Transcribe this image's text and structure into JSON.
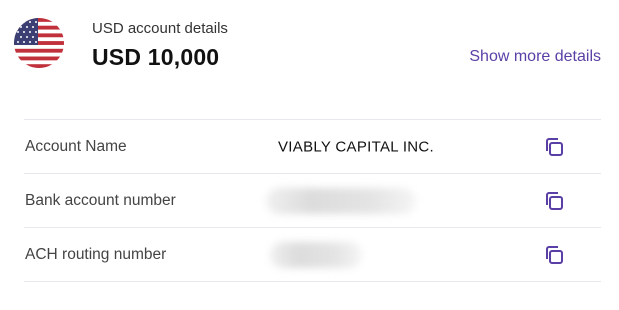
{
  "header": {
    "title": "USD account details",
    "amount": "USD 10,000",
    "show_more_label": "Show more details",
    "flag_icon": "us-flag-icon"
  },
  "rows": [
    {
      "label": "Account Name",
      "value": "VIABLY CAPITAL INC.",
      "redacted": false,
      "copy_icon": "copy-icon"
    },
    {
      "label": "Bank account number",
      "value": "",
      "redacted": true,
      "copy_icon": "copy-icon"
    },
    {
      "label": "ACH routing number",
      "value": "",
      "redacted": true,
      "copy_icon": "copy-icon"
    }
  ],
  "colors": {
    "accent": "#5a3fa6",
    "divider": "#e8e8ee"
  }
}
